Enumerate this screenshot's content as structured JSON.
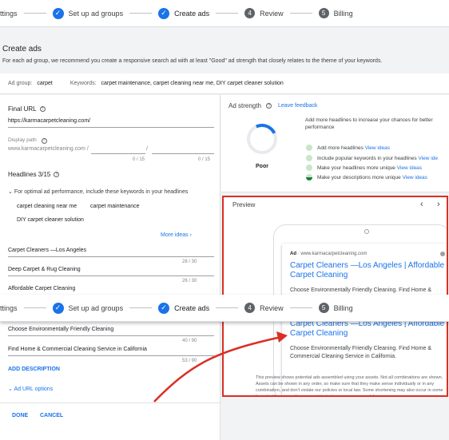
{
  "steps": [
    {
      "label": "ttings"
    },
    {
      "label": "Set up ad groups"
    },
    {
      "label": "Create ads"
    },
    {
      "num": "4",
      "label": "Review"
    },
    {
      "num": "5",
      "label": "Billing"
    }
  ],
  "page": {
    "title": "Create ads",
    "subtitle": "For each ad group, we recommend you create a responsive search ad with at least \"Good\" ad strength that closely relates to the theme of your keywords."
  },
  "adgroup": {
    "label": "Ad group:",
    "value": "carpet",
    "keywords_label": "Keywords:",
    "keywords_value": "carpet maintenance, carpet cleaning near me, DIY carpet cleaner solution"
  },
  "form": {
    "final_url_label": "Final URL",
    "final_url_value": "https://karmacarpetcleaning.com/",
    "display_path_label": "Display path",
    "display_path_base": "www.karmacarpetcleaning.com /",
    "display_path_sep": "/",
    "path1_count": "0 / 15",
    "path2_count": "0 / 15",
    "headlines_label": "Headlines 3/15",
    "keywords_hint": "For optimal ad performance, include these keywords in your headlines",
    "kw_chips": [
      "carpet cleaning near me",
      "carpet maintenance",
      "DIY carpet cleaner solution"
    ],
    "more_ideas": "More ideas",
    "headlines": [
      {
        "text": "Carpet Cleaners —Los Angeles",
        "count": "28 / 30"
      },
      {
        "text": "Deep Carpet & Rug Cleaning",
        "count": "26 / 30"
      },
      {
        "text": "Affordable Carpet Cleaning",
        "count": ""
      }
    ],
    "descriptions": [
      {
        "text": "Choose Environmentally Friendly Cleaning",
        "count": "40 / 90"
      },
      {
        "text": "Find Home & Commercial Cleaning Service in California",
        "count": "53 / 90"
      }
    ],
    "add_description": "ADD DESCRIPTION",
    "ad_url_options": "Ad URL options",
    "done": "DONE",
    "cancel": "CANCEL"
  },
  "strength": {
    "title": "Ad strength",
    "leave_feedback": "Leave feedback",
    "rating": "Poor",
    "intro": "Add more headlines to increase your chances for better performance",
    "tips": [
      {
        "text": "Add more headlines",
        "link": "View ideas"
      },
      {
        "text": "Include popular keywords in your headlines",
        "link": "View ide"
      },
      {
        "text": "Make your headlines more unique",
        "link": "View ideas"
      },
      {
        "text": "Make your descriptions more unique",
        "link": "View ideas"
      }
    ]
  },
  "preview": {
    "title": "Preview",
    "ad_badge": "Ad",
    "display_url": "www.karmacarpetcleaning.com",
    "ad_title": "Carpet Cleaners —Los Angeles | Affordable Carpet Cleaning",
    "ad_desc_partial": "Choose Environmentally Friendly Cleaning. Find Home &",
    "ad_desc": "Choose Environmentally Friendly Cleaning. Find Home & Commercial Cleaning Service in California.",
    "disclaimer": "This preview shows potential ads assembled using your assets. Not all combinations are shown. Assets can be shown in any order, so make sure that they make sense individually or in any combination, and don't violate our policies or local law. Some shortening may also occur in some formats. You can make sure certain text appears in your ad. Learn more"
  },
  "colors": {
    "accent": "#1a73e8",
    "highlight": "#d93025"
  }
}
